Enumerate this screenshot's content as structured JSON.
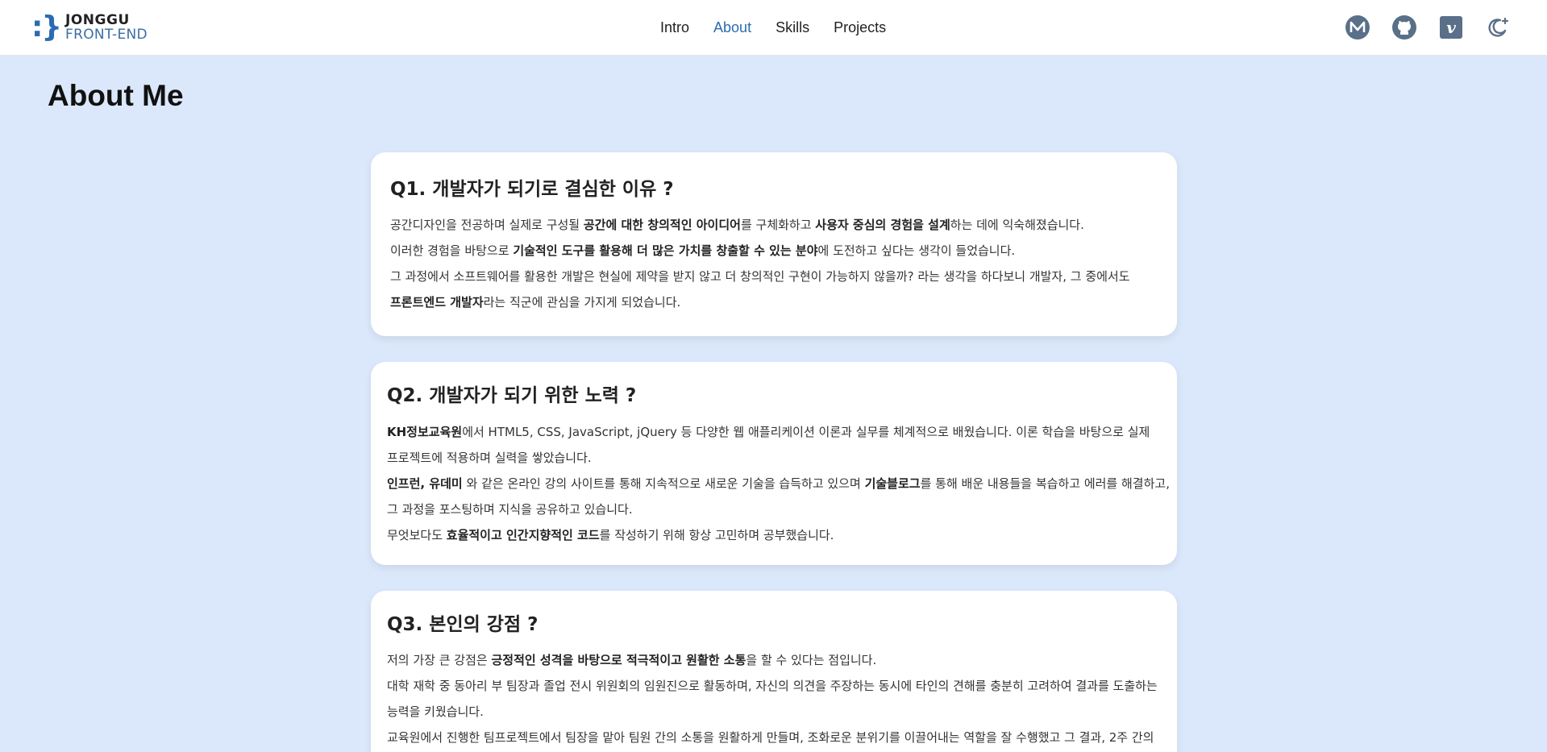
{
  "header": {
    "logo": {
      "mark": ":}",
      "name": "JONGGU",
      "sub": "FRONT-END"
    },
    "nav": [
      {
        "label": "Intro",
        "active": false
      },
      {
        "label": "About",
        "active": true
      },
      {
        "label": "Skills",
        "active": false
      },
      {
        "label": "Projects",
        "active": false
      }
    ],
    "icons": [
      "medium-icon",
      "github-icon",
      "velog-icon",
      "dark-mode-icon"
    ],
    "accent_color": "#2b6cb0"
  },
  "page": {
    "title": "About Me",
    "background": "#dbe8fb"
  },
  "cards": [
    {
      "question": "Q1. 개발자가 되기로 결심한 이유 ?",
      "lines": [
        [
          {
            "t": "공간디자인을 전공하며 실제로 구성될 "
          },
          {
            "t": "공간에 대한 창의적인 아이디어",
            "b": true
          },
          {
            "t": "를 구체화하고 "
          },
          {
            "t": "사용자 중심의 경험을 설계",
            "b": true
          },
          {
            "t": "하는 데에 익숙해졌습니다."
          }
        ],
        [
          {
            "t": "이러한 경험을 바탕으로 "
          },
          {
            "t": "기술적인 도구를 활용해 더 많은 가치를 창출할 수 있는 분야",
            "b": true
          },
          {
            "t": "에 도전하고 싶다는 생각이 들었습니다."
          }
        ],
        [
          {
            "t": "그 과정에서 소프트웨어를 활용한 개발은 현실에 제약을 받지 않고 더 창의적인 구현이 가능하지 않을까? 라는 생각을 하다보니 개발자, 그 중에서도"
          }
        ],
        [
          {
            "t": "프론트엔드 개발자",
            "b": true
          },
          {
            "t": "라는 직군에 관심을 가지게 되었습니다."
          }
        ]
      ]
    },
    {
      "question": "Q2. 개발자가 되기 위한 노력 ?",
      "lines": [
        [
          {
            "t": "KH정보교육원",
            "b": true
          },
          {
            "t": "에서 HTML5, CSS, JavaScript, jQuery 등 다양한 웹 애플리케이션 이론과 실무를 체계적으로 배웠습니다. 이론 학습을 바탕으로 실제"
          }
        ],
        [
          {
            "t": "프로젝트에 적용하며 실력을 쌓았습니다."
          }
        ],
        [
          {
            "t": "인프런, 유데미",
            "b": true
          },
          {
            "t": " 와 같은 온라인 강의 사이트를 통해 지속적으로 새로운 기술을 습득하고 있으며 "
          },
          {
            "t": "기술블로그",
            "b": true
          },
          {
            "t": "를 통해 배운 내용들을 복습하고 에러를 해결하고,"
          }
        ],
        [
          {
            "t": "그 과정을 포스팅하며 지식을 공유하고 있습니다."
          }
        ],
        [
          {
            "t": "무엇보다도 "
          },
          {
            "t": "효율적이고 인간지향적인 코드",
            "b": true
          },
          {
            "t": "를 작성하기 위해 항상 고민하며 공부했습니다."
          }
        ]
      ]
    },
    {
      "question": "Q3. 본인의 강점 ?",
      "lines": [
        [
          {
            "t": "저의 가장 큰 강점은 "
          },
          {
            "t": "긍정적인 성격을 바탕으로 적극적이고 원활한 소통",
            "b": true
          },
          {
            "t": "을 할 수 있다는 점입니다."
          }
        ],
        [
          {
            "t": "대학 재학 중 동아리 부 팀장과 졸업 전시 위원회의 임원진으로 활동하며, 자신의 의견을 주장하는 동시에 타인의 견해를 충분히 고려하여 결과를 도출하는"
          }
        ],
        [
          {
            "t": "능력을 키웠습니다."
          }
        ],
        [
          {
            "t": "교육원에서 진행한 팀프로젝트에서 팀장을 맡아 팀원 간의 소통을 원활하게 만들며, 조화로운 분위기를 이끌어내는 역할을 잘 수행했고 그 결과, 2주 간의"
          }
        ]
      ]
    }
  ]
}
